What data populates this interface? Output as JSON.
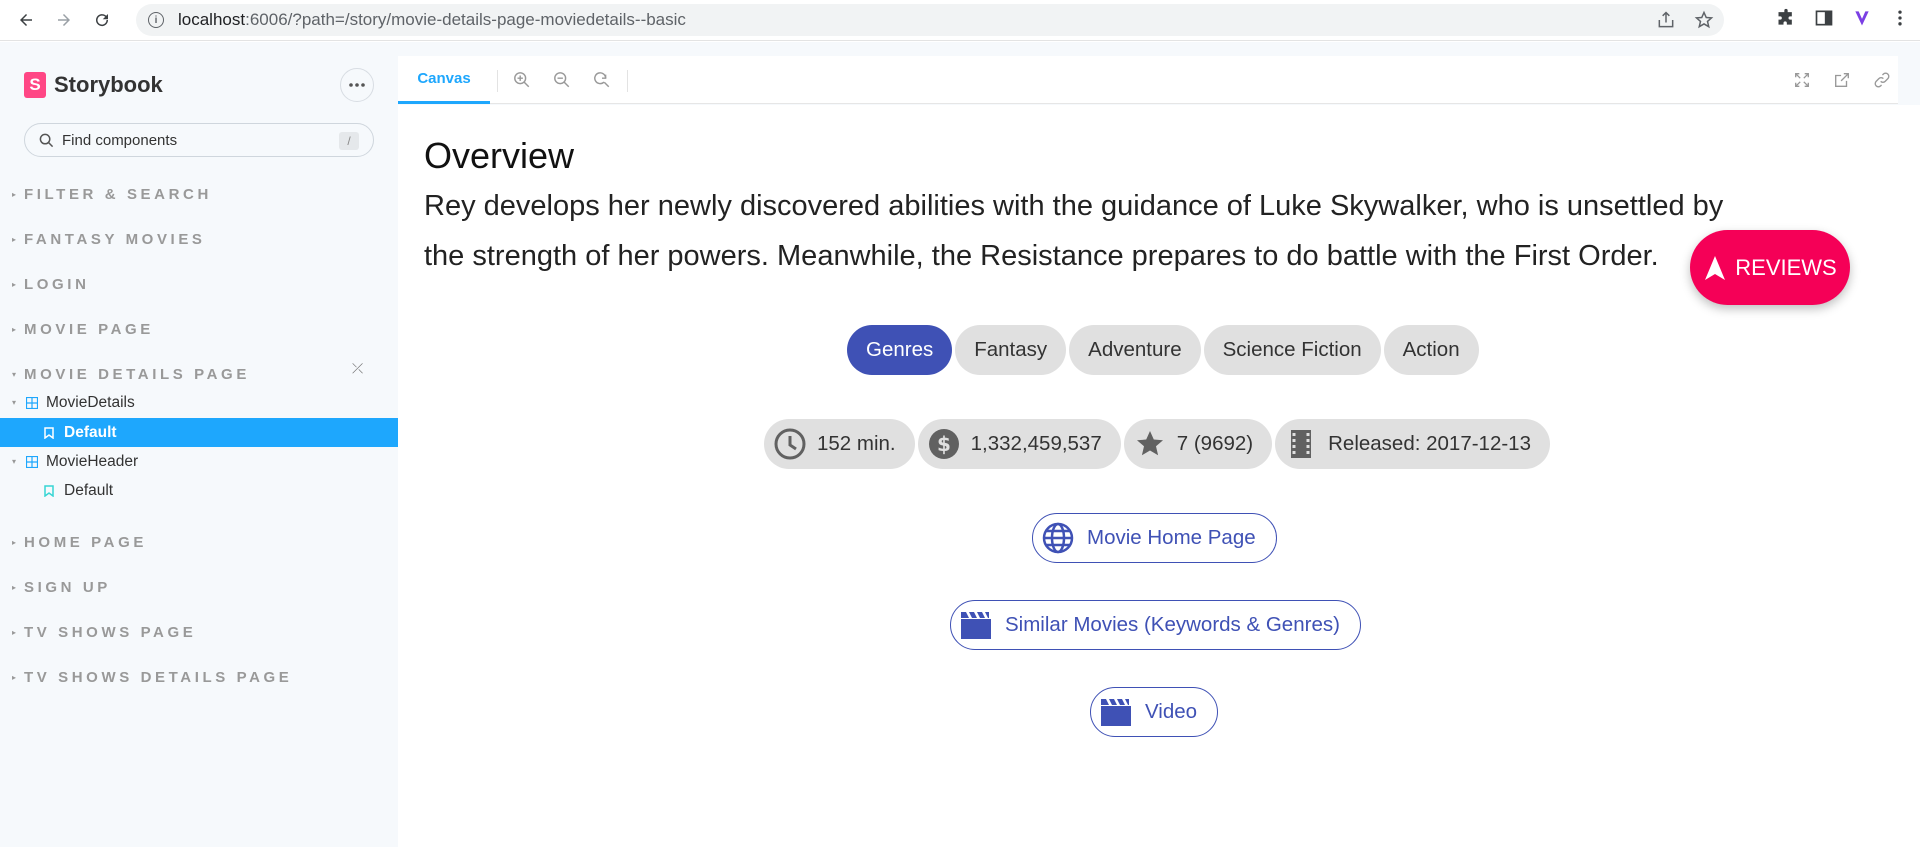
{
  "browser": {
    "url_host": "localhost",
    "url_rest": ":6006/?path=/story/movie-details-page-moviedetails--basic"
  },
  "sidebar": {
    "brand": "Storybook",
    "search_placeholder": "Find components",
    "search_shortcut": "/",
    "groups": [
      {
        "label": "FILTER & SEARCH"
      },
      {
        "label": "FANTASY MOVIES"
      },
      {
        "label": "LOGIN"
      },
      {
        "label": "MOVIE PAGE"
      },
      {
        "label": "MOVIE DETAILS PAGE"
      },
      {
        "label": "HOME PAGE"
      },
      {
        "label": "SIGN UP"
      },
      {
        "label": "TV SHOWS PAGE"
      },
      {
        "label": "TV SHOWS DETAILS PAGE"
      }
    ],
    "tree": [
      {
        "label": "MovieDetails"
      },
      {
        "label": "Default"
      },
      {
        "label": "MovieHeader"
      },
      {
        "label": "Default"
      }
    ]
  },
  "toolbar": {
    "canvas_tab": "Canvas"
  },
  "movie": {
    "overview_title": "Overview",
    "overview_line1": "Rey develops her newly discovered abilities with the guidance of Luke Skywalker, who is unsettled by",
    "overview_line2": "the strength of her powers. Meanwhile, the Resistance prepares to do battle with the First Order.",
    "reviews_label": "REVIEWS",
    "genres_label": "Genres",
    "genres": [
      "Fantasy",
      "Adventure",
      "Science Fiction",
      "Action"
    ],
    "runtime": "152 min.",
    "revenue": "1,332,459,537",
    "rating": "7 (9692)",
    "released": "Released: 2017-12-13",
    "home_page_label": "Movie Home Page",
    "similar_label": "Similar Movies (Keywords & Genres)",
    "video_label": "Video"
  },
  "colors": {
    "accent": "#1ea7fd",
    "primary": "#3f51b5",
    "reviews": "#f50057",
    "brand": "#ff4785"
  }
}
